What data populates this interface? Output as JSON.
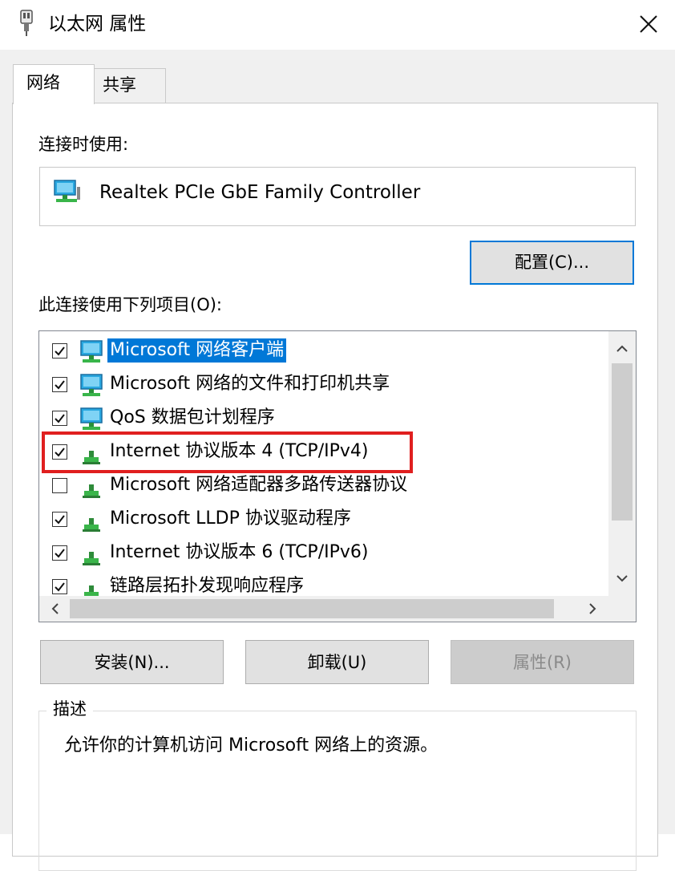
{
  "window": {
    "title": "以太网 属性",
    "icon": "ethernet-adapter-icon",
    "close_icon": "close-icon"
  },
  "tabs": [
    {
      "label": "网络",
      "active": true
    },
    {
      "label": "共享",
      "active": false
    }
  ],
  "connect_using": {
    "label": "连接时使用:",
    "adapter_name": "Realtek PCIe GbE Family Controller",
    "adapter_icon": "network-adapter-icon"
  },
  "configure_button": "配置(C)...",
  "items_label": "此连接使用下列项目(O):",
  "items": [
    {
      "label": "Microsoft 网络客户端",
      "checked": true,
      "selected": true,
      "icon": "network-client-icon"
    },
    {
      "label": "Microsoft 网络的文件和打印机共享",
      "checked": true,
      "selected": false,
      "icon": "network-service-icon"
    },
    {
      "label": "QoS 数据包计划程序",
      "checked": true,
      "selected": false,
      "icon": "network-service-icon"
    },
    {
      "label": "Internet 协议版本 4 (TCP/IPv4)",
      "checked": true,
      "selected": false,
      "icon": "protocol-icon",
      "highlighted": true
    },
    {
      "label": "Microsoft 网络适配器多路传送器协议",
      "checked": false,
      "selected": false,
      "icon": "protocol-icon"
    },
    {
      "label": "Microsoft LLDP 协议驱动程序",
      "checked": true,
      "selected": false,
      "icon": "protocol-icon"
    },
    {
      "label": "Internet 协议版本 6 (TCP/IPv6)",
      "checked": true,
      "selected": false,
      "icon": "protocol-icon"
    },
    {
      "label": "链路层拓扑发现响应程序",
      "checked": true,
      "selected": false,
      "icon": "protocol-icon"
    }
  ],
  "buttons": {
    "install": "安装(N)...",
    "uninstall": "卸载(U)",
    "properties": "属性(R)"
  },
  "description": {
    "legend": "描述",
    "text": "允许你的计算机访问 Microsoft 网络上的资源。"
  },
  "colors": {
    "selection": "#0078d7",
    "highlight_box": "#e01f1f",
    "focus_border": "#0078d7"
  }
}
